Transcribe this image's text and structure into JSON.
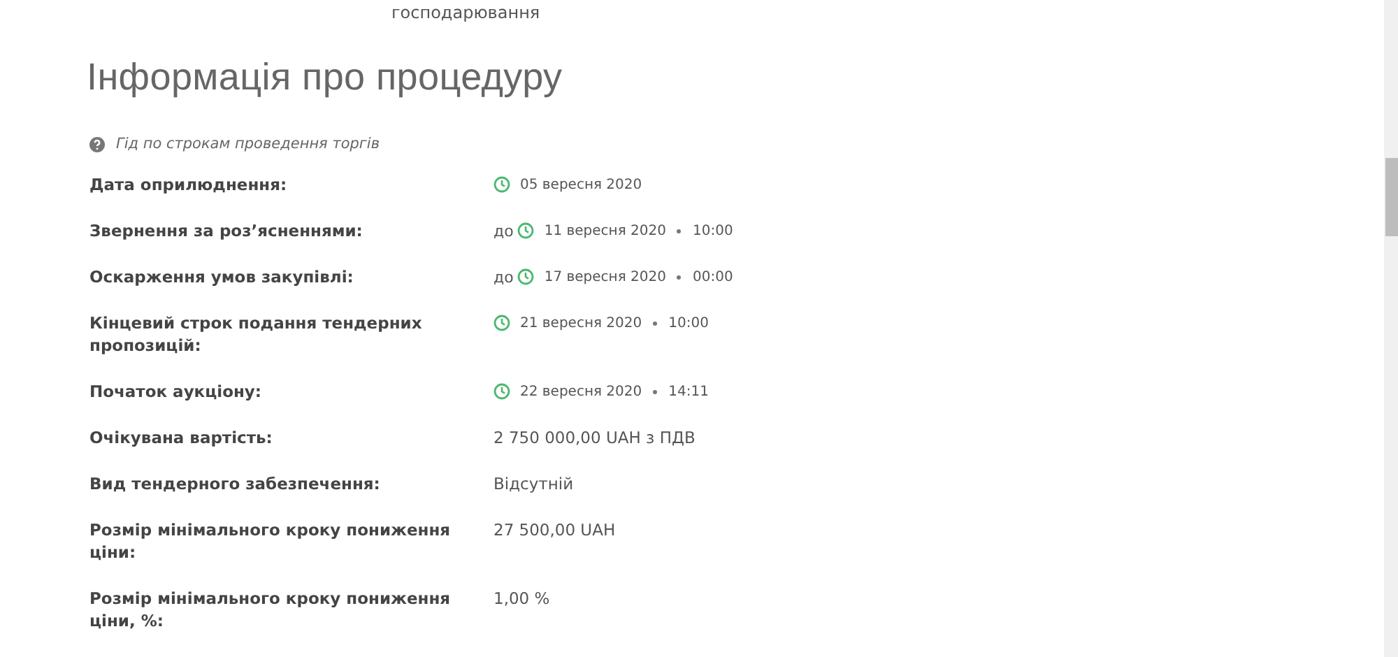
{
  "top_fragment": "господарювання",
  "heading": "Інформація про процедуру",
  "guide_link": "Гід по строкам проведення торгів",
  "rows": [
    {
      "label": "Дата оприлюднення:",
      "kind": "date",
      "date": "05 вересня 2020"
    },
    {
      "label": "Звернення за роз’ясненнями:",
      "kind": "date",
      "prefix": "до",
      "date": "11 вересня 2020",
      "time": "10:00"
    },
    {
      "label": "Оскарження умов закупівлі:",
      "kind": "date",
      "prefix": "до",
      "date": "17 вересня 2020",
      "time": "00:00"
    },
    {
      "label": "Кінцевий строк подання тендерних пропозицій:",
      "kind": "date",
      "date": "21 вересня 2020",
      "time": "10:00"
    },
    {
      "label": "Початок аукціону:",
      "kind": "date",
      "date": "22 вересня 2020",
      "time": "14:11"
    },
    {
      "label": "Очікувана вартість:",
      "kind": "text",
      "value": "2 750 000,00 UAH з ПДВ"
    },
    {
      "label": "Вид тендерного забезпечення:",
      "kind": "text",
      "value": "Відсутній"
    },
    {
      "label": "Розмір мінімального кроку пониження ціни:",
      "kind": "text",
      "value": "27 500,00 UAH"
    },
    {
      "label": "Розмір мінімального кроку пониження ціни, %:",
      "kind": "text",
      "value": "1,00 %"
    }
  ]
}
